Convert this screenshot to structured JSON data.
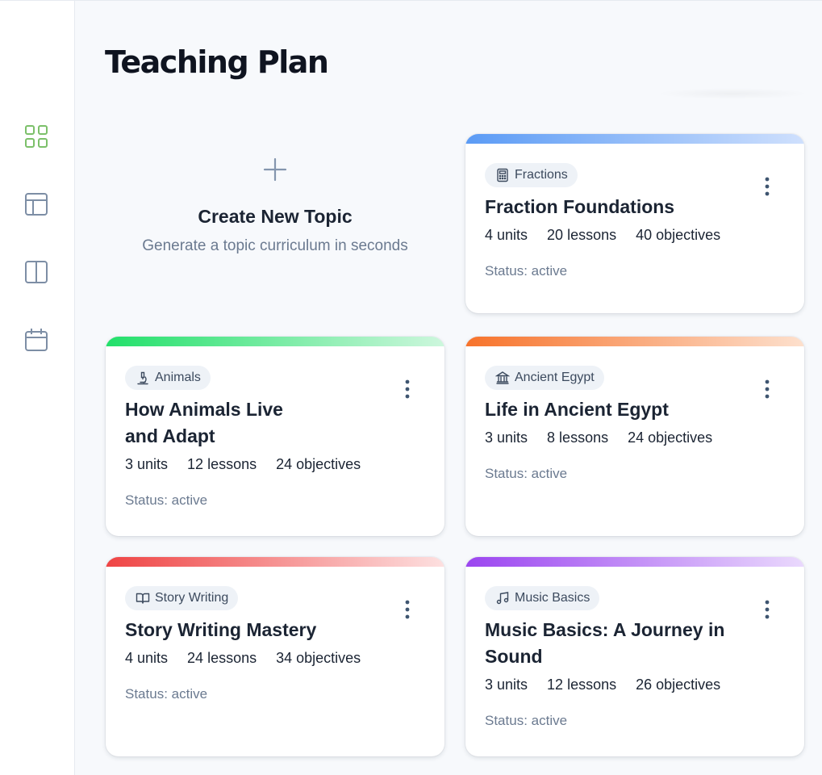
{
  "page": {
    "title": "Teaching Plan"
  },
  "sidebar": {
    "items": [
      {
        "icon": "grid-icon",
        "active": true
      },
      {
        "icon": "layout-icon",
        "active": false
      },
      {
        "icon": "columns-icon",
        "active": false
      },
      {
        "icon": "calendar-icon",
        "active": false
      }
    ]
  },
  "create": {
    "title": "Create New Topic",
    "subtitle": "Generate a topic curriculum in seconds"
  },
  "cards": [
    {
      "chip": "Fractions",
      "chip_icon": "calculator-icon",
      "title": "Fraction Foundations",
      "units": "4 units",
      "lessons": "20 lessons",
      "objectives": "40 objectives",
      "status": "Status: active",
      "accent": "#5b9bf5"
    },
    {
      "chip": "Animals",
      "chip_icon": "microscope-icon",
      "title": "How Animals Live\nand Adapt",
      "units": "3 units",
      "lessons": "12 lessons",
      "objectives": "24 objectives",
      "status": "Status: active",
      "accent": "#2ee074"
    },
    {
      "chip": "Ancient Egypt",
      "chip_icon": "landmark-icon",
      "title": "Life in Ancient Egypt",
      "units": "3 units",
      "lessons": "8 lessons",
      "objectives": "24 objectives",
      "status": "Status: active",
      "accent": "#f97a33"
    },
    {
      "chip": "Story Writing",
      "chip_icon": "book-icon",
      "title": "Story Writing Mastery",
      "units": "4 units",
      "lessons": "24 lessons",
      "objectives": "34 objectives",
      "status": "Status: active",
      "accent": "#ef4444"
    },
    {
      "chip": "Music Basics",
      "chip_icon": "music-icon",
      "title": "Music Basics: A Journey in\nSound",
      "units": "3 units",
      "lessons": "12 lessons",
      "objectives": "26 objectives",
      "status": "Status: active",
      "accent": "#9b51f0"
    }
  ],
  "colors": {
    "active_nav": "#7cc06a",
    "inactive_nav": "#7d8ea5"
  }
}
